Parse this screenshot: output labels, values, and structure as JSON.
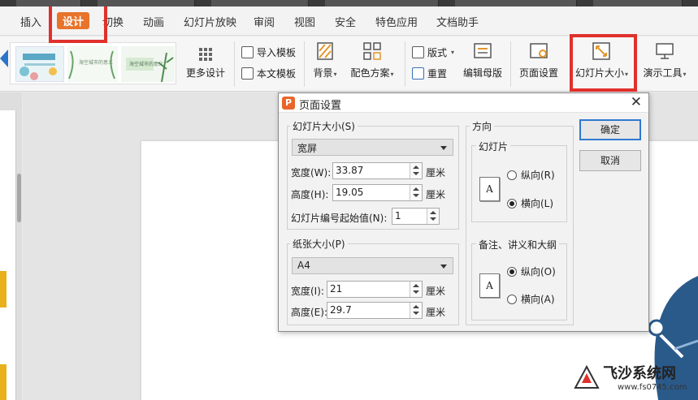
{
  "menu": {
    "items": [
      "插入",
      "设计",
      "切换",
      "动画",
      "幻灯片放映",
      "审阅",
      "视图",
      "安全",
      "特色应用",
      "文档助手"
    ],
    "active_index": 1
  },
  "ribbon": {
    "thumb_texts": [
      "海空城市的意义",
      "海空城市的意义"
    ],
    "more_design": "更多设计",
    "import_template": "导入模板",
    "text_template": "本文模板",
    "background": "背景",
    "color_scheme": "配色方案",
    "layout": "版式",
    "reset": "重置",
    "edit_master": "编辑母版",
    "page_setup": "页面设置",
    "slide_size": "幻灯片大小",
    "presenter_tools": "演示工具"
  },
  "dialog": {
    "title": "页面设置",
    "close_glyph": "✕",
    "slide_size_group": "幻灯片大小(S)",
    "slide_size_value": "宽屏",
    "width_label": "宽度(W):",
    "width_value": "33.87",
    "height_label": "高度(H):",
    "height_value": "19.05",
    "unit": "厘米",
    "start_number_label": "幻灯片编号起始值(N):",
    "start_number_value": "1",
    "paper_group": "纸张大小(P)",
    "paper_value": "A4",
    "paper_width_label": "宽度(I):",
    "paper_width_value": "21",
    "paper_height_label": "高度(E):",
    "paper_height_value": "29.7",
    "orientation_group": "方向",
    "slide_group": "幻灯片",
    "portrait": "纵向(R)",
    "landscape": "横向(L)",
    "notes_group": "备注、讲义和大纲",
    "notes_portrait": "纵向(O)",
    "notes_landscape": "横向(A)",
    "page_icon_letter": "A",
    "ok": "确定",
    "cancel": "取消",
    "slide_orientation_selected": "landscape",
    "notes_orientation_selected": "portrait"
  },
  "watermark": {
    "title": "飞沙系统网",
    "url": "www.fs0745.com"
  },
  "colors": {
    "accent_orange": "#e8732a",
    "highlight_red": "#e0302c",
    "primary_blue": "#2f78d0",
    "deco_blue": "#2a5a8a"
  },
  "icons": [
    "grid-icon",
    "import-template-icon",
    "text-template-icon",
    "background-icon",
    "color-scheme-icon",
    "layout-icon",
    "reset-icon",
    "edit-master-icon",
    "page-setup-icon",
    "slide-size-icon",
    "presenter-tools-icon",
    "close-icon",
    "app-logo-icon",
    "dropdown-arrow-icon",
    "spin-up-icon",
    "spin-down-icon",
    "portrait-page-icon"
  ]
}
